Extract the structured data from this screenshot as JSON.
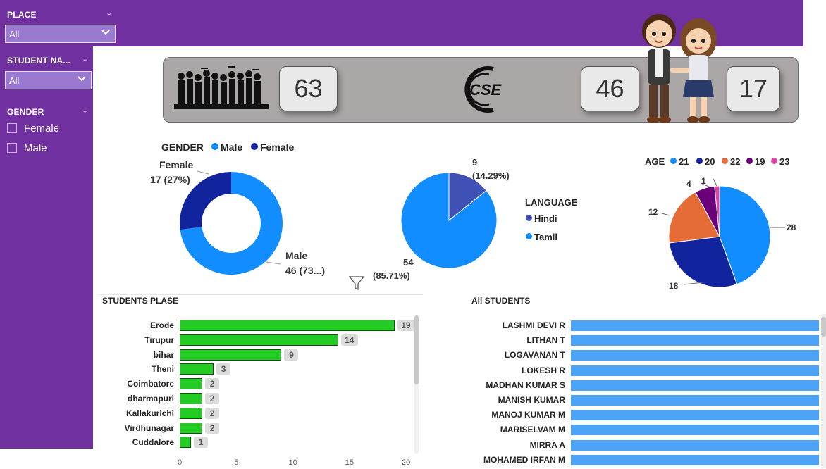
{
  "filters": {
    "place": {
      "label": "PLACE",
      "value": "All"
    },
    "student_name": {
      "label": "STUDENT NA...",
      "value": "All"
    },
    "gender": {
      "label": "GENDER",
      "options": [
        "Female",
        "Male"
      ]
    }
  },
  "kpis": {
    "total": "63",
    "male": "46",
    "female": "17"
  },
  "logo_text": "CSE",
  "gender_chart": {
    "legend_title": "GENDER",
    "legend": [
      "Male",
      "Female"
    ],
    "female_name": "Female",
    "female_value": "17 (27%)",
    "male_name": "Male",
    "male_value": "46 (73...)"
  },
  "language_chart": {
    "legend_title": "LANGUAGE",
    "legend": [
      "Hindi",
      "Tamil"
    ],
    "hindi_count": "9",
    "hindi_pct": "(14.29%)",
    "tamil_count": "54",
    "tamil_pct": "(85.71%)"
  },
  "age_chart": {
    "legend_title": "AGE",
    "legend": [
      "21",
      "20",
      "22",
      "19",
      "23"
    ],
    "labels": [
      "28",
      "18",
      "12",
      "4",
      "1"
    ]
  },
  "places_chart": {
    "title": "STUDENTS PLASE",
    "ticks": [
      "0",
      "5",
      "10",
      "15",
      "20"
    ]
  },
  "students_chart": {
    "title": "All STUDENTS"
  },
  "colors": {
    "purple": "#7030a0",
    "male": "#118dff",
    "female": "#12239e",
    "age_21": "#118dff",
    "age_20": "#12239e",
    "age_22": "#e66c37",
    "age_19": "#6b007b",
    "age_23": "#e044a7",
    "hindi": "#3f51b5",
    "bar_green": "#22cc22",
    "bar_blue": "#4da3f5"
  },
  "chart_data": [
    {
      "type": "pie",
      "title": "GENDER",
      "categories": [
        "Male",
        "Female"
      ],
      "values": [
        46,
        17
      ]
    },
    {
      "type": "pie",
      "title": "LANGUAGE",
      "categories": [
        "Hindi",
        "Tamil"
      ],
      "values": [
        9,
        54
      ]
    },
    {
      "type": "pie",
      "title": "AGE",
      "categories": [
        "21",
        "20",
        "22",
        "19",
        "23"
      ],
      "values": [
        28,
        18,
        12,
        4,
        1
      ]
    },
    {
      "type": "bar",
      "title": "STUDENTS PLASE",
      "categories": [
        "Erode",
        "Tirupur",
        "bihar",
        "Theni",
        "Coimbatore",
        "dharmapuri",
        "Kallakurichi",
        "Virdhunagar",
        "Cuddalore"
      ],
      "values": [
        19,
        14,
        9,
        3,
        2,
        2,
        2,
        2,
        1
      ],
      "xlim": [
        0,
        20
      ]
    },
    {
      "type": "bar",
      "title": "All STUDENTS",
      "categories": [
        "LASHMI DEVI R",
        "LITHAN T",
        "LOGAVANAN T",
        "LOKESH R",
        "MADHAN KUMAR S",
        "MANISH KUMAR",
        "MANOJ KUMAR M",
        "MARISELVAM M",
        "MIRRA A",
        "MOHAMED IRFAN M"
      ],
      "values": [
        1,
        1,
        1,
        1,
        1,
        1,
        1,
        1,
        1,
        1
      ]
    }
  ]
}
